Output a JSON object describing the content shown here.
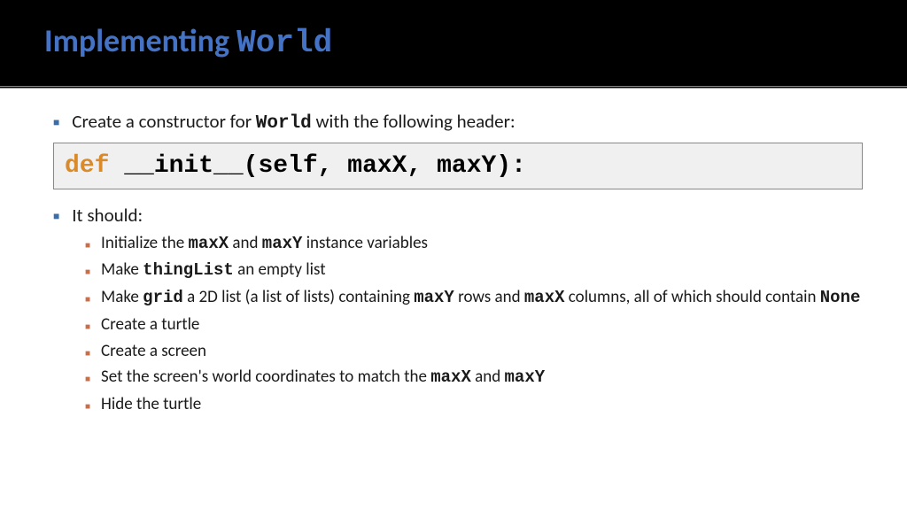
{
  "header": {
    "title_pre": "Implementing ",
    "title_mono": "World"
  },
  "content": {
    "intro_pre": "Create a constructor for ",
    "intro_mono": "World",
    "intro_post": " with the following header:",
    "code_kw": "def",
    "code_rest": " __init__(self, maxX, maxY):",
    "should_label": "It should:",
    "items": {
      "i0": {
        "pre": "Initialize the ",
        "m1": "maxX",
        "mid": " and ",
        "m2": "maxY",
        "post": " instance variables"
      },
      "i1": {
        "pre": "Make ",
        "m1": "thingList",
        "post": " an empty list"
      },
      "i2": {
        "pre": "Make ",
        "m1": "grid",
        "mid1": " a 2D list (a list of lists) containing ",
        "m2": "maxY",
        "mid2": " rows and ",
        "m3": "maxX",
        "mid3": " columns, all of which should contain ",
        "m4": "None"
      },
      "i3": {
        "pre": "Create a turtle"
      },
      "i4": {
        "pre": "Create a screen"
      },
      "i5": {
        "pre": "Set the screen's world coordinates to match the ",
        "m1": "maxX",
        "mid": " and ",
        "m2": "maxY"
      },
      "i6": {
        "pre": "Hide the turtle"
      }
    }
  }
}
